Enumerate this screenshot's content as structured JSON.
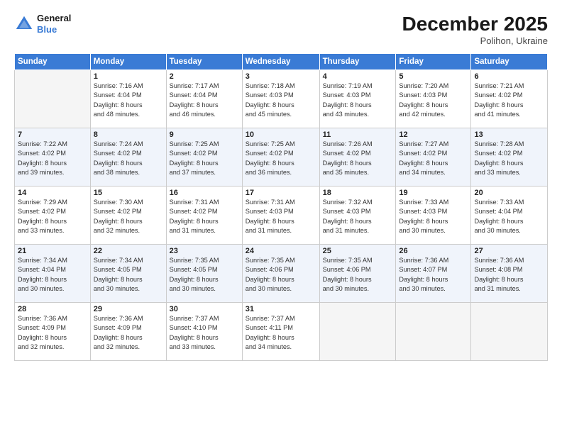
{
  "header": {
    "logo_general": "General",
    "logo_blue": "Blue",
    "month": "December 2025",
    "location": "Polihon, Ukraine"
  },
  "weekdays": [
    "Sunday",
    "Monday",
    "Tuesday",
    "Wednesday",
    "Thursday",
    "Friday",
    "Saturday"
  ],
  "weeks": [
    {
      "shaded": false,
      "days": [
        {
          "num": "",
          "info": ""
        },
        {
          "num": "1",
          "info": "Sunrise: 7:16 AM\nSunset: 4:04 PM\nDaylight: 8 hours\nand 48 minutes."
        },
        {
          "num": "2",
          "info": "Sunrise: 7:17 AM\nSunset: 4:04 PM\nDaylight: 8 hours\nand 46 minutes."
        },
        {
          "num": "3",
          "info": "Sunrise: 7:18 AM\nSunset: 4:03 PM\nDaylight: 8 hours\nand 45 minutes."
        },
        {
          "num": "4",
          "info": "Sunrise: 7:19 AM\nSunset: 4:03 PM\nDaylight: 8 hours\nand 43 minutes."
        },
        {
          "num": "5",
          "info": "Sunrise: 7:20 AM\nSunset: 4:03 PM\nDaylight: 8 hours\nand 42 minutes."
        },
        {
          "num": "6",
          "info": "Sunrise: 7:21 AM\nSunset: 4:02 PM\nDaylight: 8 hours\nand 41 minutes."
        }
      ]
    },
    {
      "shaded": true,
      "days": [
        {
          "num": "7",
          "info": "Sunrise: 7:22 AM\nSunset: 4:02 PM\nDaylight: 8 hours\nand 39 minutes."
        },
        {
          "num": "8",
          "info": "Sunrise: 7:24 AM\nSunset: 4:02 PM\nDaylight: 8 hours\nand 38 minutes."
        },
        {
          "num": "9",
          "info": "Sunrise: 7:25 AM\nSunset: 4:02 PM\nDaylight: 8 hours\nand 37 minutes."
        },
        {
          "num": "10",
          "info": "Sunrise: 7:25 AM\nSunset: 4:02 PM\nDaylight: 8 hours\nand 36 minutes."
        },
        {
          "num": "11",
          "info": "Sunrise: 7:26 AM\nSunset: 4:02 PM\nDaylight: 8 hours\nand 35 minutes."
        },
        {
          "num": "12",
          "info": "Sunrise: 7:27 AM\nSunset: 4:02 PM\nDaylight: 8 hours\nand 34 minutes."
        },
        {
          "num": "13",
          "info": "Sunrise: 7:28 AM\nSunset: 4:02 PM\nDaylight: 8 hours\nand 33 minutes."
        }
      ]
    },
    {
      "shaded": false,
      "days": [
        {
          "num": "14",
          "info": "Sunrise: 7:29 AM\nSunset: 4:02 PM\nDaylight: 8 hours\nand 33 minutes."
        },
        {
          "num": "15",
          "info": "Sunrise: 7:30 AM\nSunset: 4:02 PM\nDaylight: 8 hours\nand 32 minutes."
        },
        {
          "num": "16",
          "info": "Sunrise: 7:31 AM\nSunset: 4:02 PM\nDaylight: 8 hours\nand 31 minutes."
        },
        {
          "num": "17",
          "info": "Sunrise: 7:31 AM\nSunset: 4:03 PM\nDaylight: 8 hours\nand 31 minutes."
        },
        {
          "num": "18",
          "info": "Sunrise: 7:32 AM\nSunset: 4:03 PM\nDaylight: 8 hours\nand 31 minutes."
        },
        {
          "num": "19",
          "info": "Sunrise: 7:33 AM\nSunset: 4:03 PM\nDaylight: 8 hours\nand 30 minutes."
        },
        {
          "num": "20",
          "info": "Sunrise: 7:33 AM\nSunset: 4:04 PM\nDaylight: 8 hours\nand 30 minutes."
        }
      ]
    },
    {
      "shaded": true,
      "days": [
        {
          "num": "21",
          "info": "Sunrise: 7:34 AM\nSunset: 4:04 PM\nDaylight: 8 hours\nand 30 minutes."
        },
        {
          "num": "22",
          "info": "Sunrise: 7:34 AM\nSunset: 4:05 PM\nDaylight: 8 hours\nand 30 minutes."
        },
        {
          "num": "23",
          "info": "Sunrise: 7:35 AM\nSunset: 4:05 PM\nDaylight: 8 hours\nand 30 minutes."
        },
        {
          "num": "24",
          "info": "Sunrise: 7:35 AM\nSunset: 4:06 PM\nDaylight: 8 hours\nand 30 minutes."
        },
        {
          "num": "25",
          "info": "Sunrise: 7:35 AM\nSunset: 4:06 PM\nDaylight: 8 hours\nand 30 minutes."
        },
        {
          "num": "26",
          "info": "Sunrise: 7:36 AM\nSunset: 4:07 PM\nDaylight: 8 hours\nand 30 minutes."
        },
        {
          "num": "27",
          "info": "Sunrise: 7:36 AM\nSunset: 4:08 PM\nDaylight: 8 hours\nand 31 minutes."
        }
      ]
    },
    {
      "shaded": false,
      "days": [
        {
          "num": "28",
          "info": "Sunrise: 7:36 AM\nSunset: 4:09 PM\nDaylight: 8 hours\nand 32 minutes."
        },
        {
          "num": "29",
          "info": "Sunrise: 7:36 AM\nSunset: 4:09 PM\nDaylight: 8 hours\nand 32 minutes."
        },
        {
          "num": "30",
          "info": "Sunrise: 7:37 AM\nSunset: 4:10 PM\nDaylight: 8 hours\nand 33 minutes."
        },
        {
          "num": "31",
          "info": "Sunrise: 7:37 AM\nSunset: 4:11 PM\nDaylight: 8 hours\nand 34 minutes."
        },
        {
          "num": "",
          "info": ""
        },
        {
          "num": "",
          "info": ""
        },
        {
          "num": "",
          "info": ""
        }
      ]
    }
  ]
}
